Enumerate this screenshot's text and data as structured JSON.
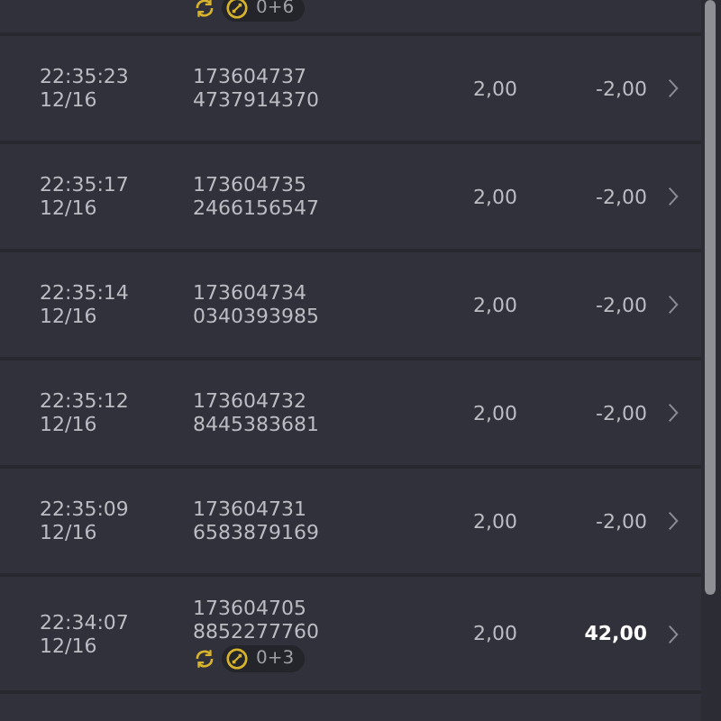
{
  "previous_bet": {
    "extras": "0+6"
  },
  "bets": [
    {
      "time": "22:35:23",
      "date": "12/16",
      "id_line_1": "173604737",
      "id_line_2": "4737914370",
      "stake": "2,00",
      "result": "-2,00",
      "won": false
    },
    {
      "time": "22:35:17",
      "date": "12/16",
      "id_line_1": "173604735",
      "id_line_2": "2466156547",
      "stake": "2,00",
      "result": "-2,00",
      "won": false
    },
    {
      "time": "22:35:14",
      "date": "12/16",
      "id_line_1": "173604734",
      "id_line_2": "0340393985",
      "stake": "2,00",
      "result": "-2,00",
      "won": false
    },
    {
      "time": "22:35:12",
      "date": "12/16",
      "id_line_1": "173604732",
      "id_line_2": "8445383681",
      "stake": "2,00",
      "result": "-2,00",
      "won": false
    },
    {
      "time": "22:35:09",
      "date": "12/16",
      "id_line_1": "173604731",
      "id_line_2": "6583879169",
      "stake": "2,00",
      "result": "-2,00",
      "won": false
    },
    {
      "time": "22:34:07",
      "date": "12/16",
      "id_line_1": "173604705",
      "id_line_2": "8852277760",
      "stake": "2,00",
      "result": "42,00",
      "won": true,
      "extras": "0+3"
    }
  ]
}
